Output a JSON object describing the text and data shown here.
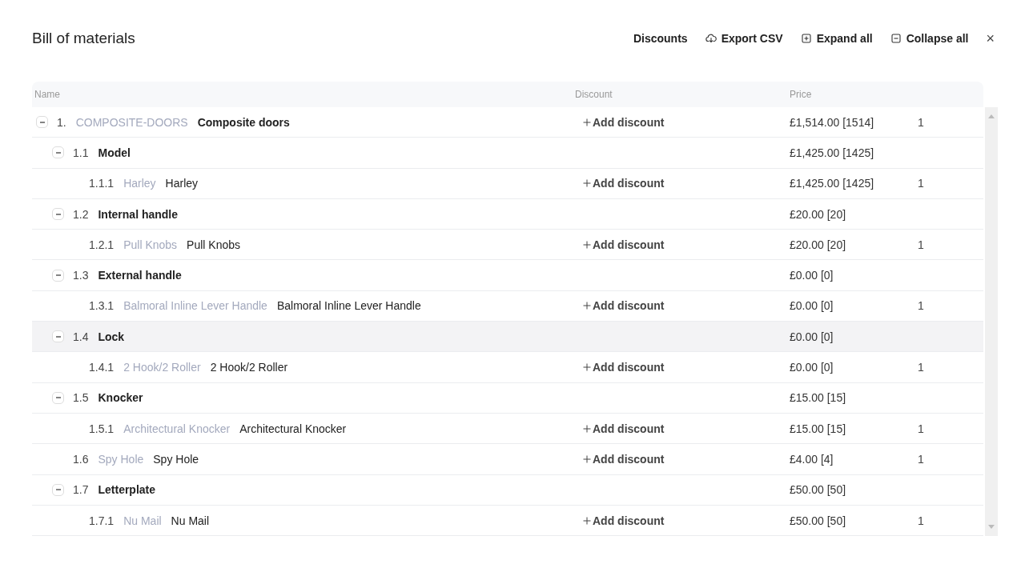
{
  "title": "Bill of materials",
  "actions": [
    {
      "kind": "text",
      "label": "Discounts"
    },
    {
      "kind": "export",
      "label": "Export CSV"
    },
    {
      "kind": "expand",
      "label": "Expand all"
    },
    {
      "kind": "collapse",
      "label": "Collapse all"
    }
  ],
  "close": "×",
  "columns": [
    "Name",
    "Discount",
    "Price"
  ],
  "rows": [
    {
      "kind": "group",
      "number": "1.",
      "code": "COMPOSITE-DOORS",
      "name": "Composite doors",
      "discount": "Add discount",
      "price": "£1,514.00 [1514]",
      "quantity": "1",
      "expanded": true,
      "highlighted": false,
      "children": [
        {
          "kind": "group",
          "number": "1.1",
          "name": "Model",
          "price": "£1,425.00 [1425]",
          "expanded": true,
          "highlighted": false,
          "children": [
            {
              "kind": "item",
              "number": "1.1.1",
              "code": "Harley",
              "name": "Harley",
              "discount": "Add discount",
              "price": "£1,425.00 [1425]",
              "quantity": "1",
              "highlighted": false
            }
          ]
        },
        {
          "kind": "group",
          "number": "1.2",
          "name": "Internal handle",
          "price": "£20.00 [20]",
          "expanded": true,
          "highlighted": false,
          "children": [
            {
              "kind": "item",
              "number": "1.2.1",
              "code": "Pull Knobs",
              "name": "Pull Knobs",
              "discount": "Add discount",
              "price": "£20.00 [20]",
              "quantity": "1",
              "highlighted": false
            }
          ]
        },
        {
          "kind": "group",
          "number": "1.3",
          "name": "External handle",
          "price": "£0.00 [0]",
          "expanded": true,
          "highlighted": false,
          "children": [
            {
              "kind": "item",
              "number": "1.3.1",
              "code": "Balmoral Inline Lever Handle",
              "name": "Balmoral Inline Lever Handle",
              "discount": "Add discount",
              "price": "£0.00 [0]",
              "quantity": "1",
              "highlighted": false
            }
          ]
        },
        {
          "kind": "group",
          "number": "1.4",
          "name": "Lock",
          "price": "£0.00 [0]",
          "expanded": true,
          "highlighted": true,
          "children": [
            {
              "kind": "item",
              "number": "1.4.1",
              "code": "2 Hook/2 Roller",
              "name": "2 Hook/2 Roller",
              "discount": "Add discount",
              "price": "£0.00 [0]",
              "quantity": "1",
              "highlighted": false
            }
          ]
        },
        {
          "kind": "group",
          "number": "1.5",
          "name": "Knocker",
          "price": "£15.00 [15]",
          "expanded": true,
          "highlighted": false,
          "children": [
            {
              "kind": "item",
              "number": "1.5.1",
              "code": "Architectural Knocker",
              "name": "Architectural Knocker",
              "discount": "Add discount",
              "price": "£15.00 [15]",
              "quantity": "1",
              "highlighted": false
            }
          ]
        },
        {
          "kind": "item",
          "number": "1.6",
          "code": "Spy Hole",
          "name": "Spy Hole",
          "discount": "Add discount",
          "price": "£4.00 [4]",
          "quantity": "1",
          "highlighted": false
        },
        {
          "kind": "group",
          "number": "1.7",
          "name": "Letterplate",
          "price": "£50.00 [50]",
          "expanded": true,
          "highlighted": false,
          "children": [
            {
              "kind": "item",
              "number": "1.7.1",
              "code": "Nu Mail",
              "name": "Nu Mail",
              "discount": "Add discount",
              "price": "£50.00 [50]",
              "quantity": "1",
              "highlighted": false
            }
          ]
        }
      ]
    }
  ]
}
